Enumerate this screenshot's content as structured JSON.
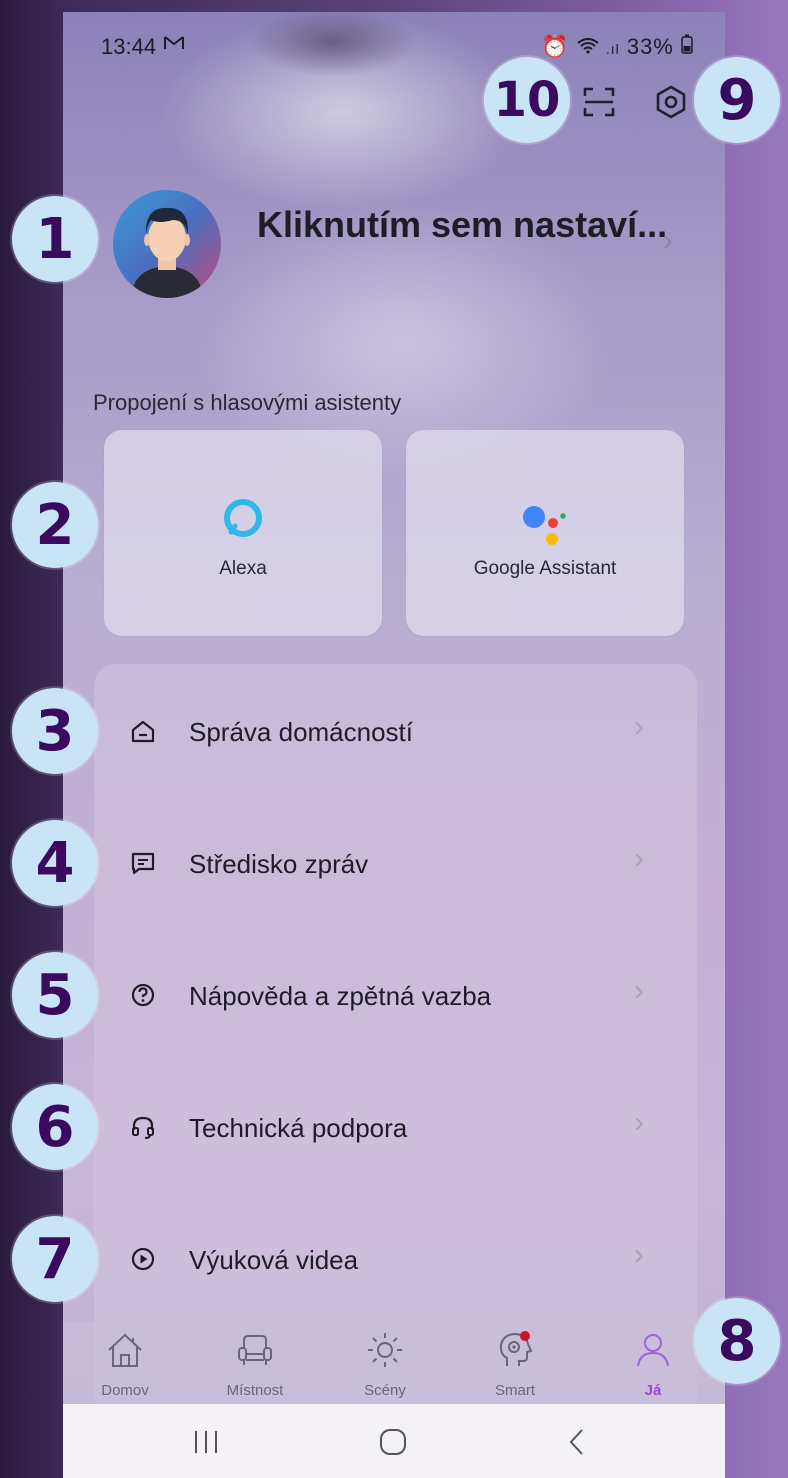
{
  "status_bar": {
    "time": "13:44",
    "battery": "33%"
  },
  "profile": {
    "name": "Kliknutím sem nastaví..."
  },
  "voice_section": {
    "label": "Propojení s hlasovými asistenty",
    "assistants": [
      {
        "label": "Alexa"
      },
      {
        "label": "Google Assistant"
      }
    ]
  },
  "menu": {
    "items": [
      {
        "label": "Správa domácností",
        "icon": "home-icon"
      },
      {
        "label": "Středisko zpráv",
        "icon": "message-icon"
      },
      {
        "label": "Nápověda a zpětná vazba",
        "icon": "help-icon"
      },
      {
        "label": "Technická podpora",
        "icon": "headset-icon"
      },
      {
        "label": "Výuková videa",
        "icon": "play-icon"
      }
    ]
  },
  "bottom_nav": {
    "items": [
      {
        "label": "Domov"
      },
      {
        "label": "Místnost"
      },
      {
        "label": "Scény"
      },
      {
        "label": "Smart"
      },
      {
        "label": "Já"
      }
    ],
    "active_index": 4
  },
  "callouts": [
    "1",
    "2",
    "3",
    "4",
    "5",
    "6",
    "7",
    "8",
    "9",
    "10"
  ],
  "colors": {
    "accent": "#9a4ad0",
    "badge_fill": "#c8e4f6",
    "badge_text": "#3a0a5e"
  }
}
